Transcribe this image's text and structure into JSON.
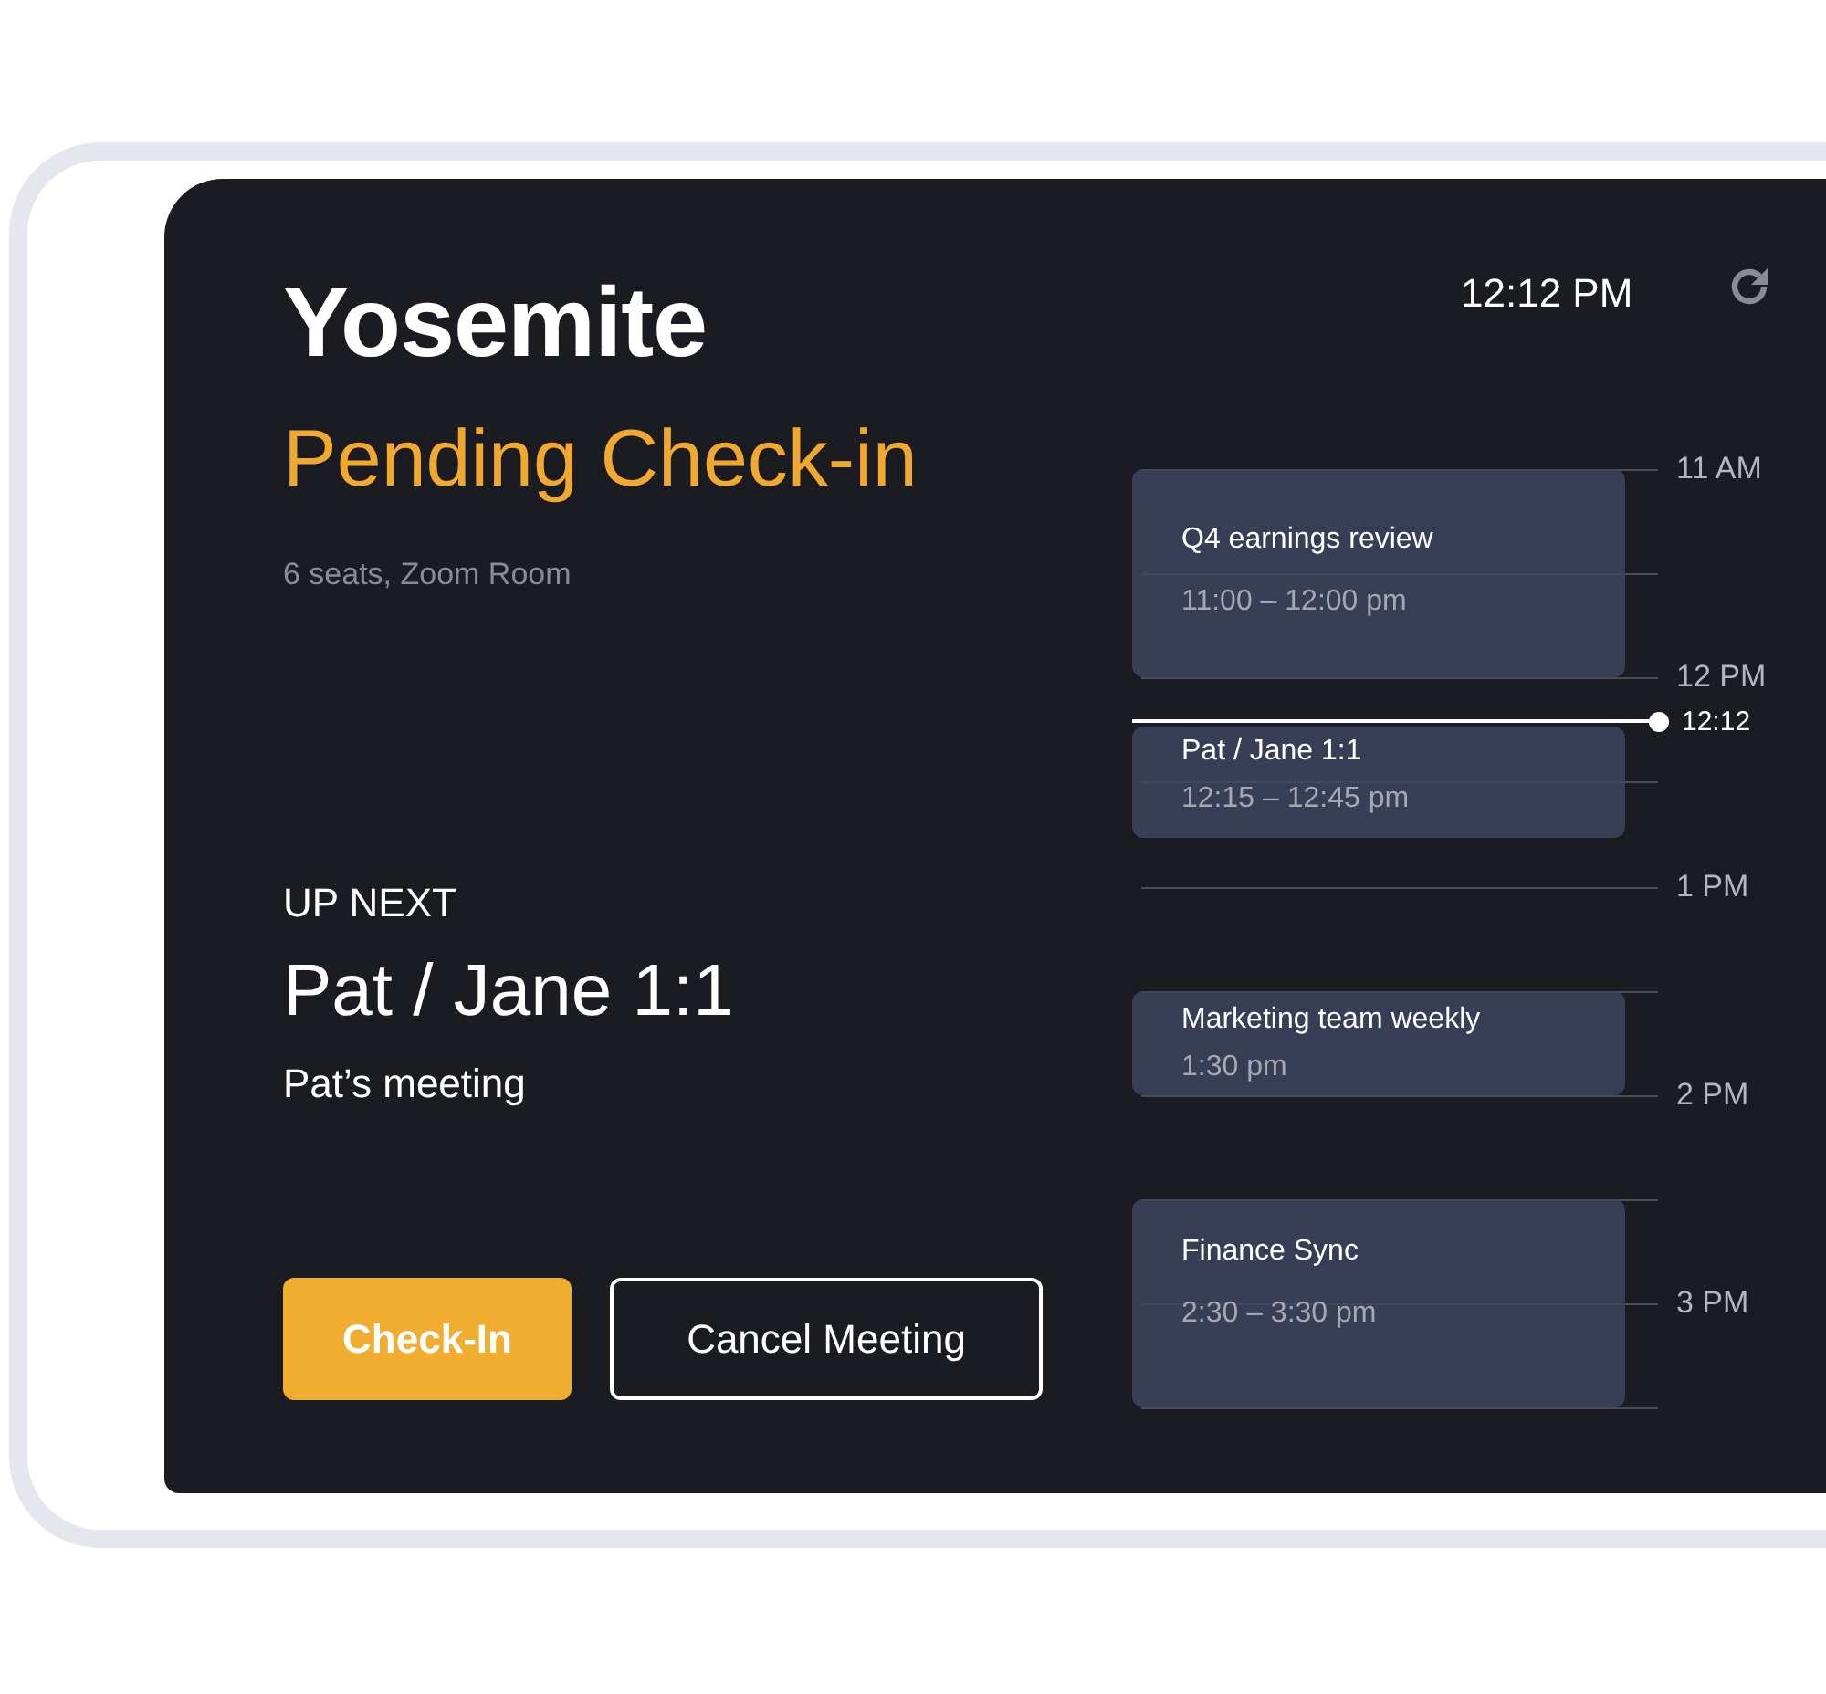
{
  "room": {
    "name": "Yosemite",
    "status": "Pending Check-in",
    "details": "6 seats, Zoom Room"
  },
  "clock": "12:12 PM",
  "up_next": {
    "label": "UP NEXT",
    "title": "Pat / Jane 1:1",
    "organizer": "Pat’s meeting"
  },
  "buttons": [
    {
      "label": "Check-In",
      "kind": "primary"
    },
    {
      "label": "Cancel Meeting",
      "kind": "outline"
    }
  ],
  "timeline": {
    "hours": [
      "11 AM",
      "12 PM",
      "1 PM",
      "2 PM",
      "3 PM"
    ],
    "now": "12:12",
    "events": [
      {
        "title": "Q4 earnings review",
        "time": "11:00 – 12:00 pm"
      },
      {
        "title": "Pat / Jane 1:1",
        "time": "12:15 – 12:45 pm"
      },
      {
        "title": "Marketing team weekly",
        "time": "1:30 pm"
      },
      {
        "title": "Finance Sync",
        "time": "2:30 – 3:30 pm"
      }
    ]
  }
}
